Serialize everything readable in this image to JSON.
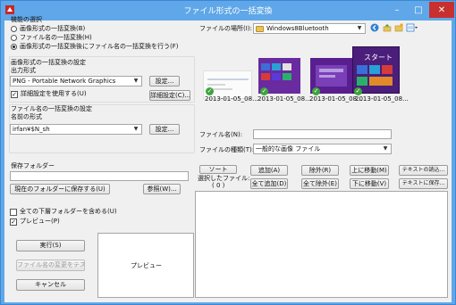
{
  "window": {
    "title": "ファイル形式の一括変換"
  },
  "function_select": {
    "title": "機能の選択",
    "options": [
      "画像形式の一括変換(B)",
      "ファイル名の一括変換(H)",
      "画像形式の一括変換後にファイル名の一括変換を行う(F)"
    ],
    "selected_index": 2
  },
  "image_format": {
    "title": "画像形式の一括変換の設定",
    "output_label": "出力形式",
    "output_value": "PNG - Portable Network Graphics",
    "settings_button": "設定...",
    "detail_check_label": "詳細設定を使用する(U)",
    "detail_checked": true,
    "detail_button": "詳細設定(C)..."
  },
  "filename_conv": {
    "title": "ファイル名の一括変換の設定",
    "name_label": "名前の形式",
    "name_value": "irfan¥$N_sh",
    "settings_button": "設定..."
  },
  "save_folder": {
    "label": "保存フォルダー",
    "value": "",
    "current_button": "現在のフォルダーに保存する(U)",
    "browse_button": "参照(W)..."
  },
  "options": {
    "include_subfolders": "全ての下層フォルダーを含める(U)",
    "include_subfolders_checked": false,
    "preview": "プレビュー(P)",
    "preview_checked": true
  },
  "actions": {
    "run": "実行(S)",
    "test_rename": "ファイル名の変更をテスト",
    "cancel": "キャンセル"
  },
  "preview_panel": {
    "label": "プレビュー"
  },
  "browser": {
    "location_label": "ファイルの場所(I):",
    "location_value": "Windows8Bluetooth",
    "thumbnails": [
      {
        "name": "2013-01-05_08...",
        "checked": true
      },
      {
        "name": "2013-01-05_08...",
        "checked": true
      },
      {
        "name": "2013-01-05_08...",
        "checked": true
      },
      {
        "name": "2013-01-05_08...",
        "checked": true
      }
    ],
    "filename_label": "ファイル名(N):",
    "filename_value": "",
    "filetype_label": "ファイルの種類(T):",
    "filetype_value": "一般的な画像 ファイル"
  },
  "list_buttons": {
    "sort": "ソート",
    "selected_files_label": "選択したファイル:",
    "selected_count": "( 0 )",
    "add": "追加(A)",
    "add_all": "全て追加(D)",
    "remove": "除外(R)",
    "remove_all": "全て除外(E)",
    "move_up": "上に移動(M)",
    "move_down": "下に移動(V)",
    "load_text": "テキストの読込...",
    "save_text": "テキストに保存..."
  },
  "colors": {
    "titlebar": "#5fa7e8",
    "close": "#c7302f",
    "accent_green": "#3da43d"
  },
  "icons": [
    "window-app-icon",
    "folder-icon",
    "back-icon",
    "up-folder-icon",
    "new-folder-icon",
    "view-menu-icon"
  ]
}
